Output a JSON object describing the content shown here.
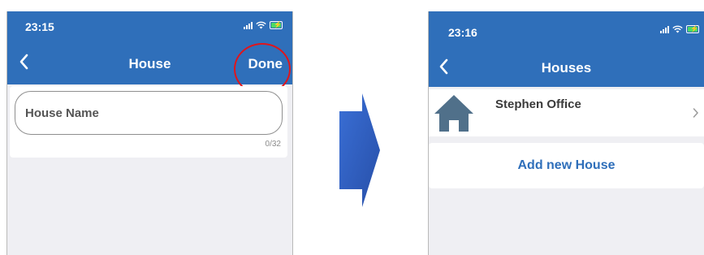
{
  "before": {
    "status": {
      "time": "23:15"
    },
    "nav": {
      "title": "House",
      "done_label": "Done"
    },
    "form": {
      "name_placeholder": "House Name",
      "name_value": "",
      "char_counter": "0/32"
    }
  },
  "after": {
    "status": {
      "time": "23:16"
    },
    "nav": {
      "title": "Houses"
    },
    "houses": [
      {
        "name": "Stephen Office"
      }
    ],
    "add_label": "Add new House"
  },
  "colors": {
    "header_blue": "#2f6fba",
    "highlight_red": "#e0151b",
    "screen_bg": "#efeff3",
    "house_icon": "#50708a"
  },
  "icons": [
    "back-chevron-icon",
    "signal-icon",
    "wifi-icon",
    "battery-charging-icon",
    "house-icon",
    "chevron-right-icon",
    "transition-arrow-icon"
  ]
}
